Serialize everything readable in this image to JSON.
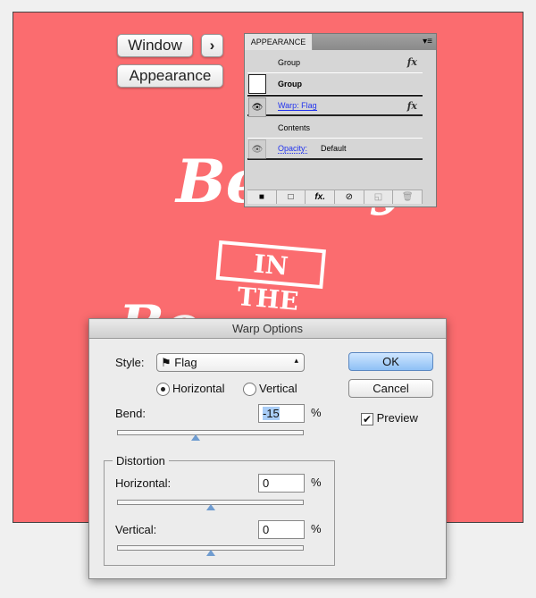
{
  "artwork": {
    "line1": "Beauty",
    "banner": "IN THE",
    "line3": "Bo",
    "color": "#fb6c6f"
  },
  "menu": {
    "window": "Window",
    "chevron": "›",
    "appearance": "Appearance"
  },
  "appearance_panel": {
    "tab": "APPEARANCE",
    "rows": [
      {
        "label": "Group",
        "fx": "fx"
      },
      {
        "label": "Group"
      },
      {
        "label": "Warp: Flag",
        "fx": "fx"
      },
      {
        "label": "Contents"
      },
      {
        "label": "Opacity:",
        "value": "Default"
      }
    ],
    "footer": [
      "■",
      "□",
      "fx.",
      "⊘",
      "◱",
      "🗑"
    ]
  },
  "warp_dialog": {
    "title": "Warp Options",
    "style_label": "Style:",
    "style_value": "Flag",
    "orientation": [
      "Horizontal",
      "Vertical"
    ],
    "selected": "Horizontal",
    "bend_label": "Bend:",
    "bend": "-15",
    "pct": "%",
    "bend_value": -15,
    "distortion_label": "Distortion",
    "horizontal_label": "Horizontal:",
    "horizontal": "0",
    "vertical_label": "Vertical:",
    "vertical": "0",
    "ok": "OK",
    "cancel": "Cancel",
    "preview": "Preview",
    "preview_checked": true
  }
}
